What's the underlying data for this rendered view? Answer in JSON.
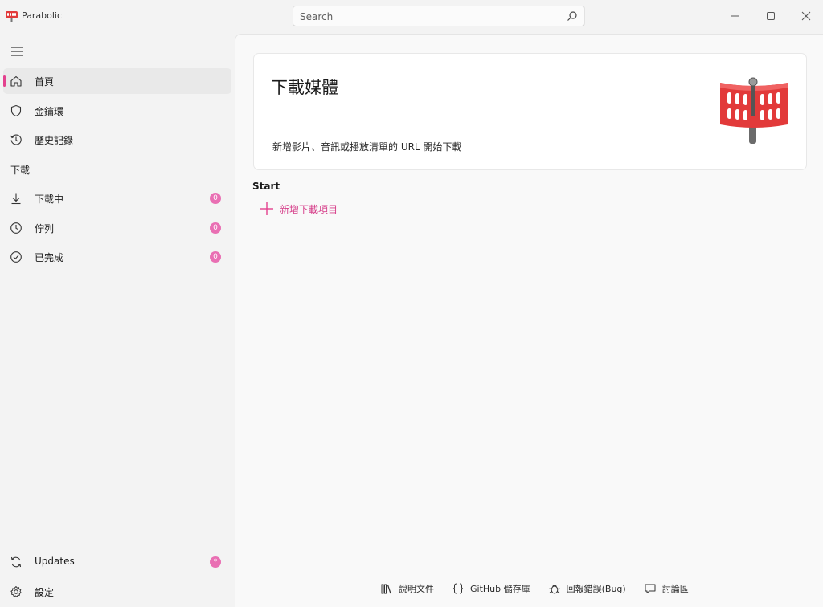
{
  "app": {
    "title": "Parabolic"
  },
  "search": {
    "placeholder": "Search"
  },
  "sidebar": {
    "items": [
      {
        "label": "首頁",
        "icon": "home-icon",
        "active": true
      },
      {
        "label": "金鑰環",
        "icon": "shield-icon"
      },
      {
        "label": "歷史記錄",
        "icon": "history-icon"
      }
    ],
    "section_header": "下載",
    "download_items": [
      {
        "label": "下載中",
        "icon": "download-icon",
        "badge": "0"
      },
      {
        "label": "佇列",
        "icon": "clock-icon",
        "badge": "0"
      },
      {
        "label": "已完成",
        "icon": "check-circle-icon",
        "badge": "0"
      }
    ],
    "bottom_items": [
      {
        "label": "Updates",
        "icon": "refresh-icon",
        "badge": "*"
      },
      {
        "label": "設定",
        "icon": "gear-icon"
      }
    ]
  },
  "hero": {
    "title": "下載媒體",
    "subtitle": "新增影片、音訊或播放清單的 URL 開始下載"
  },
  "start": {
    "label": "Start",
    "add_label": "新增下載項目"
  },
  "footer": {
    "links": [
      {
        "label": "說明文件",
        "icon": "library-icon"
      },
      {
        "label": "GitHub 儲存庫",
        "icon": "code-braces-icon"
      },
      {
        "label": "回報錯誤(Bug)",
        "icon": "bug-icon"
      },
      {
        "label": "討論區",
        "icon": "chat-icon"
      }
    ]
  },
  "colors": {
    "accent": "#e3418e",
    "badge": "#e96fb3",
    "logo_red": "#e23a3a"
  }
}
